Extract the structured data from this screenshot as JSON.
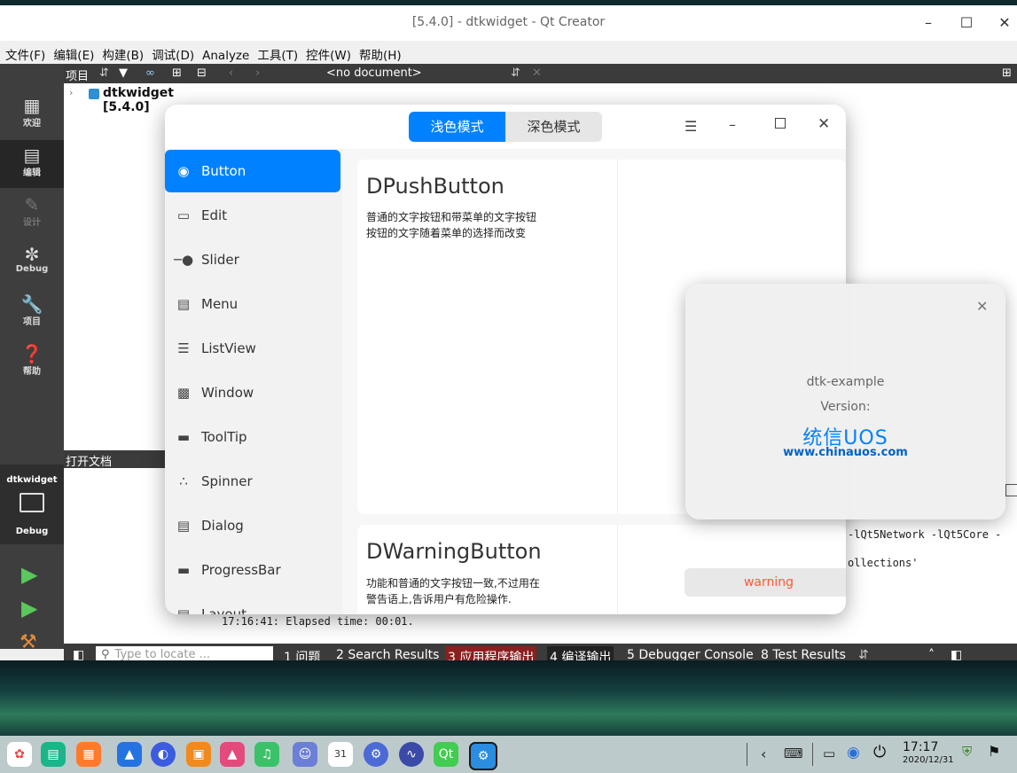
{
  "qt": {
    "window_title": "[5.4.0] - dtkwidget - Qt Creator",
    "menu": [
      "文件(F)",
      "编辑(E)",
      "构建(B)",
      "调试(D)",
      "Analyze",
      "工具(T)",
      "控件(W)",
      "帮助(H)"
    ],
    "toolbar_projects": "项目",
    "toolbar_document": "<no document>",
    "project_node": "dtkwidget [5.4.0]",
    "open_documents": "打开文档",
    "modes": [
      "欢迎",
      "编辑",
      "设计",
      "Debug",
      "项目",
      "帮助"
    ],
    "kit_name": "dtkwidget",
    "kit_mode": "Debug",
    "output_lines": [
      "-lQt5Network -lQt5Core -",
      "ollections'",
      "17:16:41: Elapsed time: 00:01."
    ],
    "locate_placeholder": "Type to locate ...",
    "output_tabs": [
      "1 问题",
      "2 Search Results",
      "3 应用程序输出",
      "4 编译输出",
      "5 Debugger Console",
      "8 Test Results"
    ]
  },
  "dtk": {
    "mode_light": "浅色模式",
    "mode_dark": "深色模式",
    "nav": [
      {
        "label": "Button",
        "icon": "toggle-icon"
      },
      {
        "label": "Edit",
        "icon": "edit-icon"
      },
      {
        "label": "Slider",
        "icon": "slider-icon"
      },
      {
        "label": "Menu",
        "icon": "menu-icon"
      },
      {
        "label": "ListView",
        "icon": "listview-icon"
      },
      {
        "label": "Window",
        "icon": "window-icon"
      },
      {
        "label": "ToolTip",
        "icon": "tooltip-icon"
      },
      {
        "label": "Spinner",
        "icon": "spinner-icon"
      },
      {
        "label": "Dialog",
        "icon": "dialog-icon"
      },
      {
        "label": "ProgressBar",
        "icon": "progressbar-icon"
      },
      {
        "label": "Layout",
        "icon": "layout-icon"
      }
    ],
    "card1_title": "DPushButton",
    "card1_desc1": "普通的文字按钮和带菜单的文字按钮",
    "card1_desc2": "按钮的文字随着菜单的选择而改变",
    "card2_title": "DWarningButton",
    "card2_desc1": "功能和普通的文字按钮一致,不过用在",
    "card2_desc2": "警告语上,告诉用户有危险操作.",
    "warning_label": "warning",
    "accent": "#0081ff",
    "warning_color": "#ff5736"
  },
  "about": {
    "app_name": "dtk-example",
    "version_label": "Version:",
    "logo_text": "统信UOS",
    "website": "www.chinauos.com"
  },
  "taskbar": {
    "time": "17:17",
    "date": "2020/12/31"
  }
}
